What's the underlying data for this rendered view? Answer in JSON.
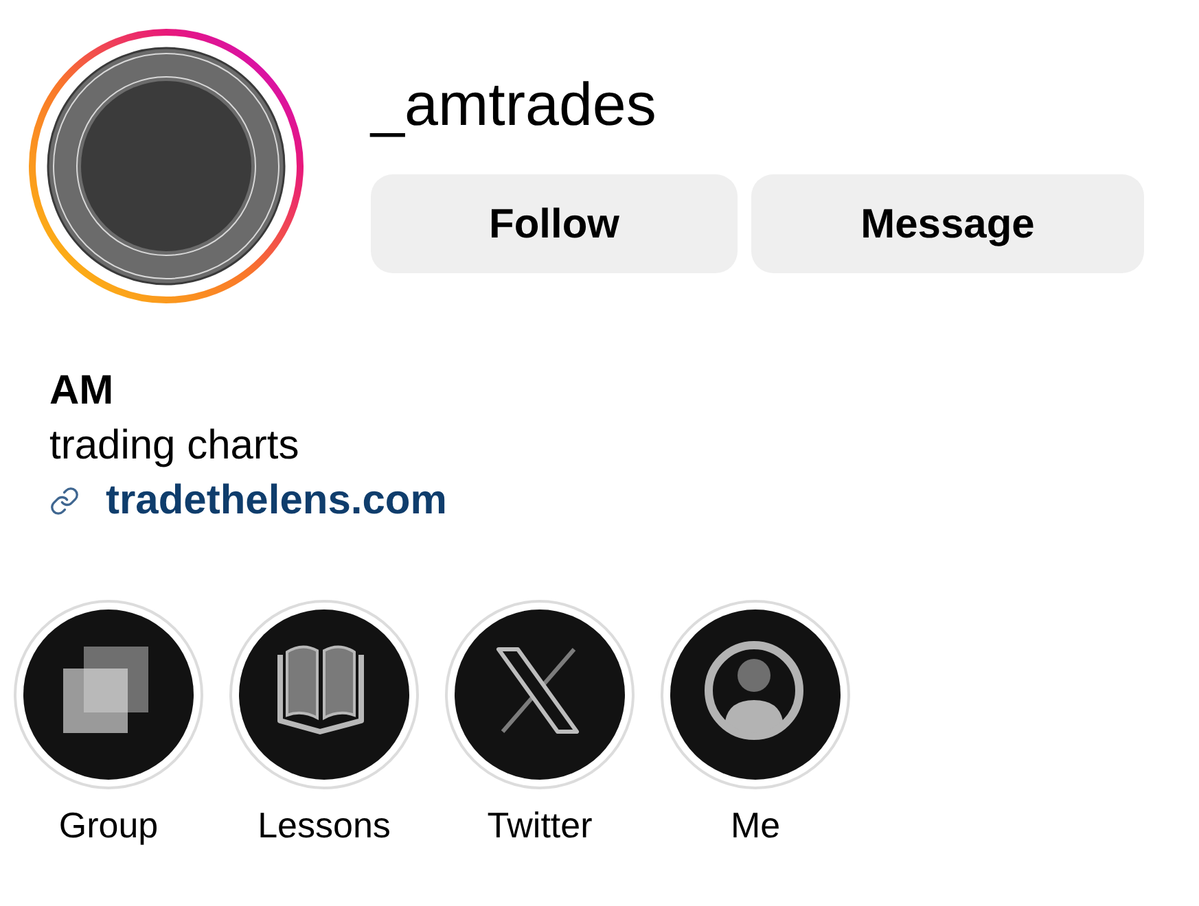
{
  "avatar": {
    "has_story": true
  },
  "profile": {
    "username": "_amtrades"
  },
  "buttons": [
    "Follow",
    "Message"
  ],
  "bio": {
    "name": "AM",
    "text": "trading charts",
    "link": "tradethelens.com"
  },
  "highlights": [
    {
      "label": "Group"
    },
    {
      "label": "Lessons"
    },
    {
      "label": "Twitter"
    },
    {
      "label": "Me"
    }
  ]
}
